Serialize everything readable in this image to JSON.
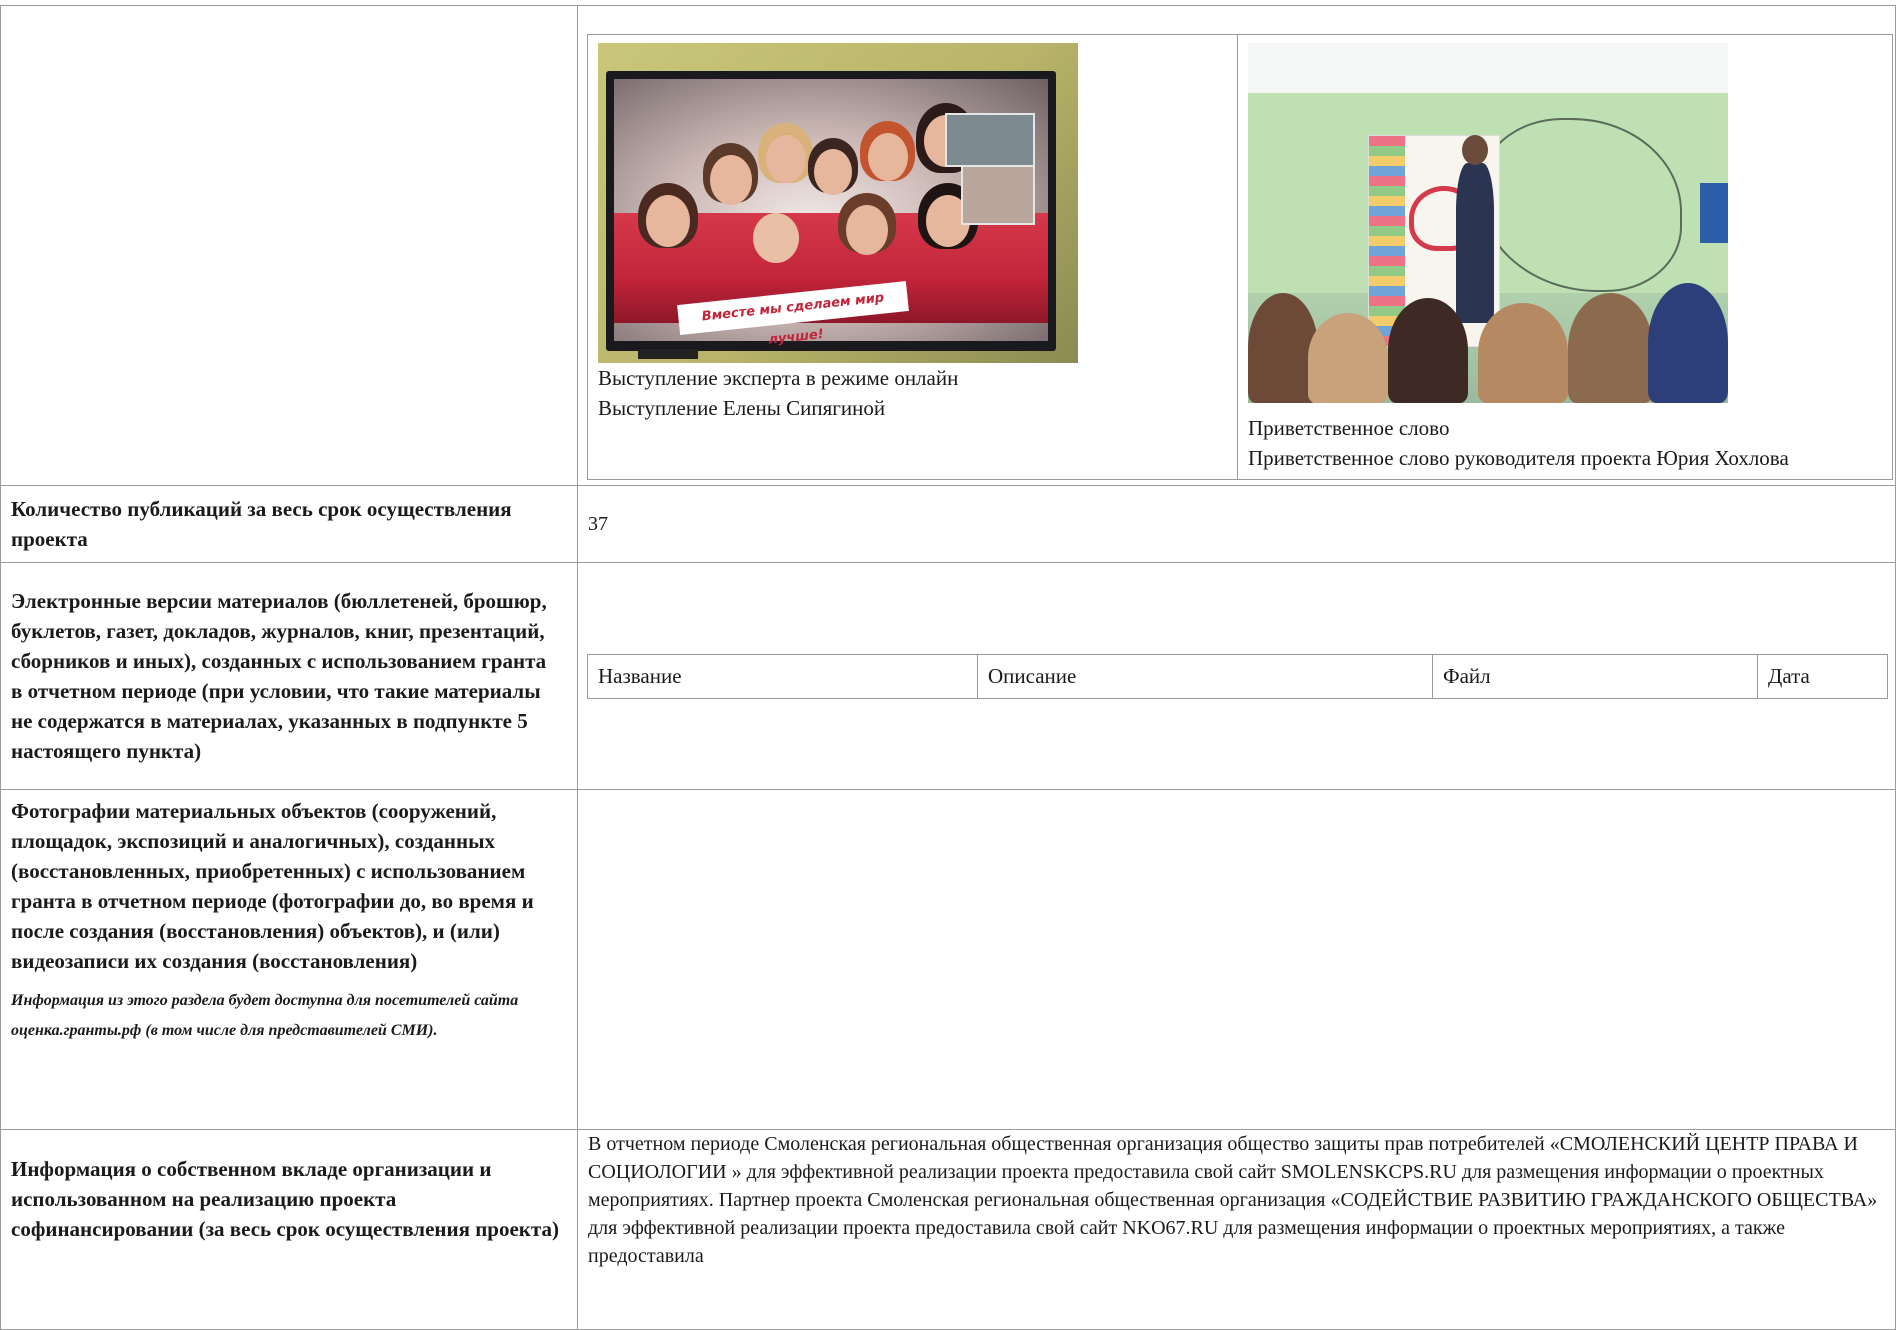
{
  "photos": [
    {
      "image": "tv-screen-group-photo",
      "banner_text": "Вместе мы сделаем мир лучше!",
      "caption_title": "Выступление эксперта в режиме онлайн",
      "caption_text": "Выступление Елены Сипягиной"
    },
    {
      "image": "presentation-room-photo",
      "caption_title": "Приветственное слово",
      "caption_text": "Приветственное слово руководителя проекта Юрия Хохлова"
    }
  ],
  "rows": {
    "publications": {
      "label": "Количество публикаций за весь срок осуществления проекта",
      "value": "37"
    },
    "electronic": {
      "label": "Электронные версии материалов (бюллетеней, брошюр, буклетов, газет, докладов, журналов, книг, презентаций, сборников и иных), созданных с использованием гранта в отчетном периоде (при условии, что такие материалы не содержатся в материалах, указанных в подпункте 5 настоящего пункта)",
      "columns": [
        "Название",
        "Описание",
        "Файл",
        "Дата"
      ]
    },
    "photos_objects": {
      "label": "Фотографии материальных объектов (сооружений, площадок, экспозиций и аналогичных), созданных (восстановленных, приобретенных) с использованием гранта в отчетном периоде (фотографии до, во время и после создания (восстановления) объектов), и (или) видеозаписи их создания (восстановления)",
      "note": "Информация из этого раздела будет доступна для посетителей сайта оценка.гранты.рф (в том числе для представителей СМИ)."
    },
    "contribution": {
      "label": "Информация о собственном вкладе организации и использованном на реализацию проекта софинансировании (за весь срок осуществления проекта)",
      "text": "В отчетном периоде Смоленская региональная общественная организация общество защиты прав потребителей «СМОЛЕНСКИЙ ЦЕНТР ПРАВА И СОЦИОЛОГИИ » для эффективной реализации проекта предоставила свой сайт SMOLENSKCPS.RU для размещения информации о проектных мероприятиях. Партнер проекта Смоленская региональная общественная организация «СОДЕЙСТВИЕ РАЗВИТИЮ ГРАЖДАНСКОГО ОБЩЕСТВА» для эффективной реализации проекта предоставила свой сайт NKO67.RU для размещения информации о проектных мероприятиях, а также предоставила"
    }
  }
}
